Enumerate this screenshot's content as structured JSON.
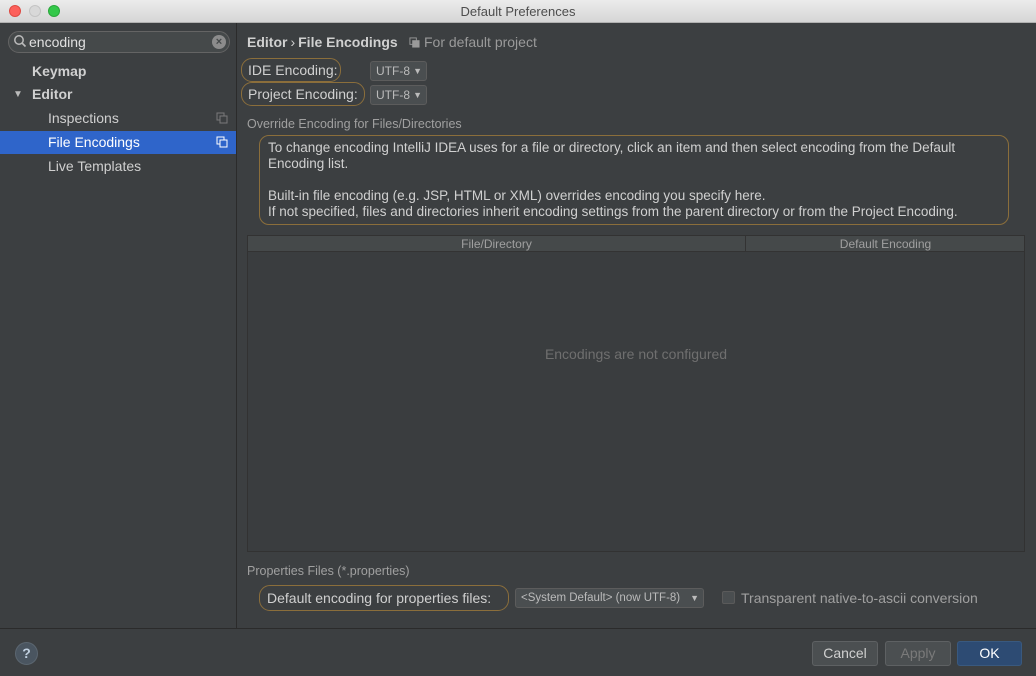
{
  "window": {
    "title": "Default Preferences"
  },
  "sidebar": {
    "search": {
      "value": "encoding",
      "placeholder": ""
    },
    "items": [
      {
        "label": "Keymap",
        "bold": true
      },
      {
        "label": "Editor",
        "bold": true,
        "expanded": true
      },
      {
        "label": "Inspections"
      },
      {
        "label": "File Encodings",
        "selected": true
      },
      {
        "label": "Live Templates"
      }
    ]
  },
  "header": {
    "breadcrumb": [
      "Editor",
      "File Encodings"
    ],
    "separator": "›",
    "scope": "For default project"
  },
  "encodings": {
    "ide_label": "IDE Encoding:",
    "ide_value": "UTF-8",
    "project_label": "Project Encoding:",
    "project_value": "UTF-8"
  },
  "override": {
    "title": "Override Encoding for Files/Directories",
    "info_line1": "To change encoding IntelliJ IDEA uses for a file or directory, click an item and then select encoding from the Default Encoding list.",
    "info_line2": "Built-in file encoding (e.g. JSP, HTML or XML) overrides encoding you specify here.",
    "info_line3": "If not specified, files and directories inherit encoding settings from the parent directory or from the Project Encoding.",
    "table": {
      "columns": [
        "File/Directory",
        "Default Encoding"
      ],
      "empty_text": "Encodings are not configured"
    }
  },
  "properties": {
    "title": "Properties Files (*.properties)",
    "default_label": "Default encoding for properties files:",
    "default_value": "<System Default> (now UTF-8)",
    "transparent_label": "Transparent native-to-ascii conversion",
    "transparent_checked": false
  },
  "footer": {
    "help": "?",
    "cancel": "Cancel",
    "apply": "Apply",
    "ok": "OK"
  },
  "colors": {
    "selection": "#2f65ca",
    "highlight_outline": "#8b6e3b",
    "background": "#3c3f41"
  }
}
